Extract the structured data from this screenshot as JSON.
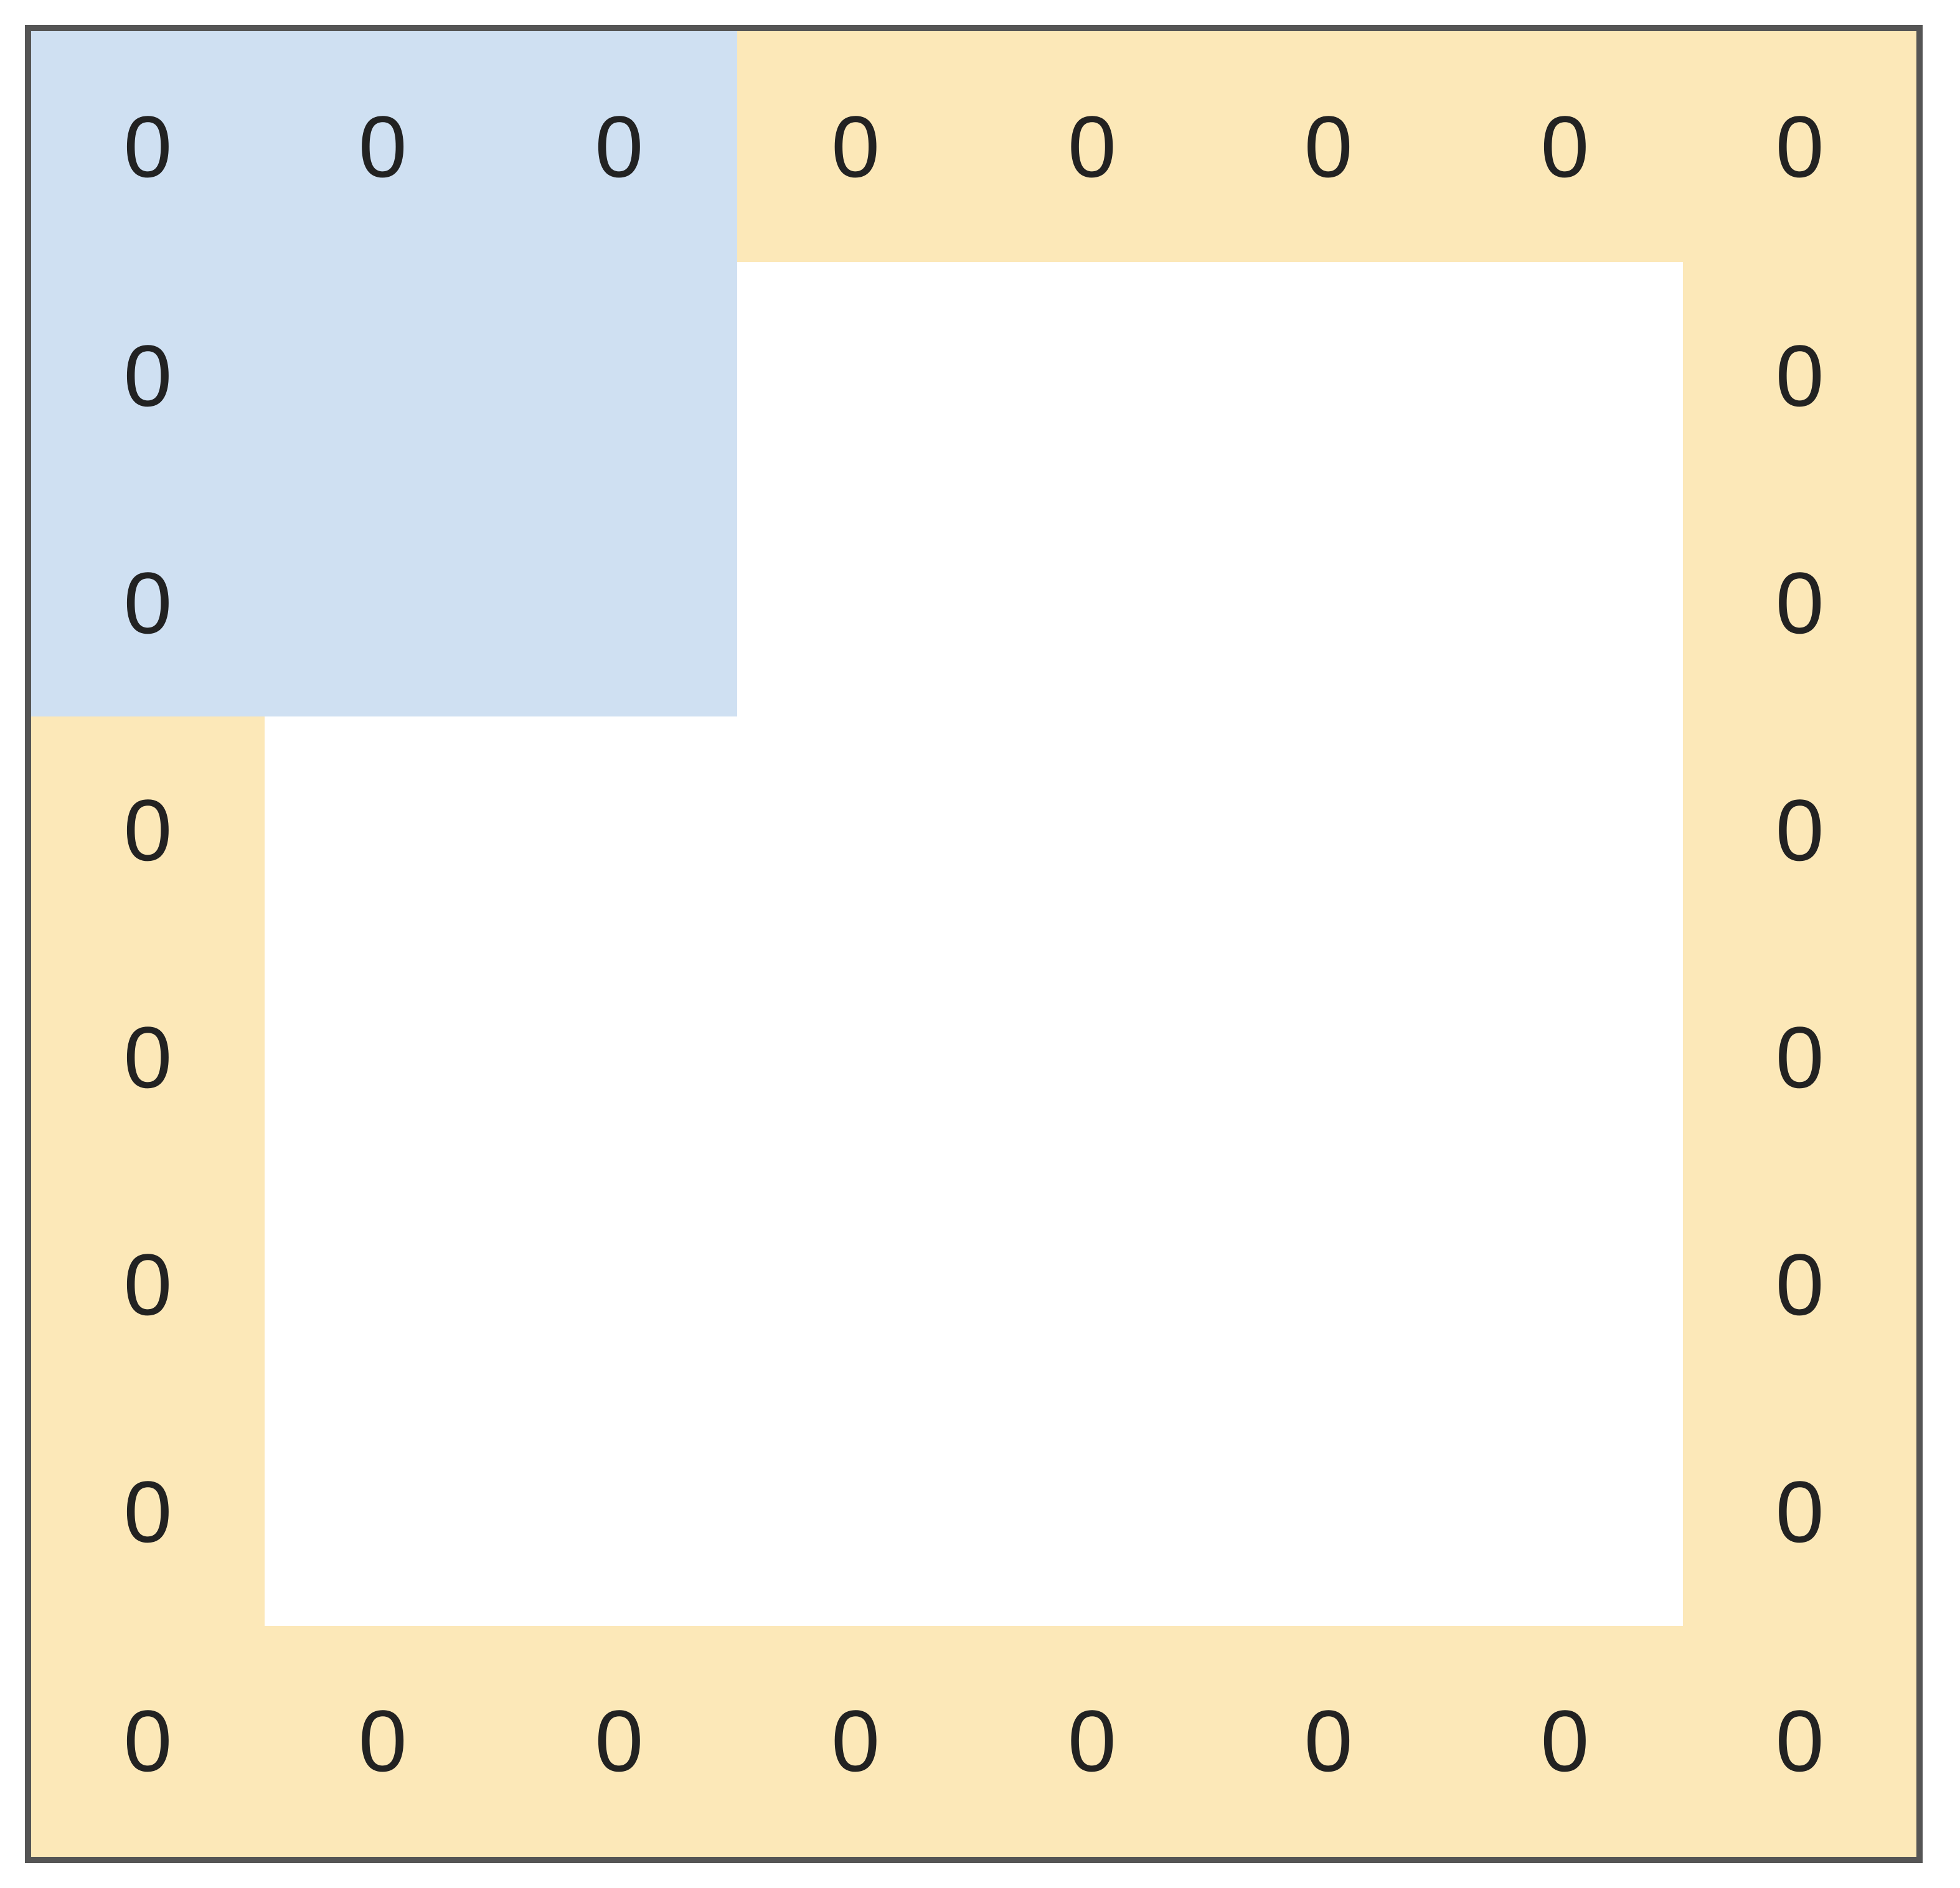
{
  "grid": {
    "rows": 8,
    "cols": 8,
    "blue_block": {
      "row_start": 0,
      "row_end": 2,
      "col_start": 0,
      "col_end": 2
    },
    "cells": [
      [
        {
          "text": "0",
          "zone": "blue"
        },
        {
          "text": "0",
          "zone": "blue"
        },
        {
          "text": "0",
          "zone": "blue"
        },
        {
          "text": "0",
          "zone": "tan"
        },
        {
          "text": "0",
          "zone": "tan"
        },
        {
          "text": "0",
          "zone": "tan"
        },
        {
          "text": "0",
          "zone": "tan"
        },
        {
          "text": "0",
          "zone": "tan"
        }
      ],
      [
        {
          "text": "0",
          "zone": "blue"
        },
        {
          "text": "",
          "zone": "blue"
        },
        {
          "text": "",
          "zone": "blue"
        },
        {
          "text": "",
          "zone": "white"
        },
        {
          "text": "",
          "zone": "white"
        },
        {
          "text": "",
          "zone": "white"
        },
        {
          "text": "",
          "zone": "white"
        },
        {
          "text": "0",
          "zone": "tan"
        }
      ],
      [
        {
          "text": "0",
          "zone": "blue"
        },
        {
          "text": "",
          "zone": "blue"
        },
        {
          "text": "",
          "zone": "blue"
        },
        {
          "text": "",
          "zone": "white"
        },
        {
          "text": "",
          "zone": "white"
        },
        {
          "text": "",
          "zone": "white"
        },
        {
          "text": "",
          "zone": "white"
        },
        {
          "text": "0",
          "zone": "tan"
        }
      ],
      [
        {
          "text": "0",
          "zone": "tan"
        },
        {
          "text": "",
          "zone": "white"
        },
        {
          "text": "",
          "zone": "white"
        },
        {
          "text": "",
          "zone": "white"
        },
        {
          "text": "",
          "zone": "white"
        },
        {
          "text": "",
          "zone": "white"
        },
        {
          "text": "",
          "zone": "white"
        },
        {
          "text": "0",
          "zone": "tan"
        }
      ],
      [
        {
          "text": "0",
          "zone": "tan"
        },
        {
          "text": "",
          "zone": "white"
        },
        {
          "text": "",
          "zone": "white"
        },
        {
          "text": "",
          "zone": "white"
        },
        {
          "text": "",
          "zone": "white"
        },
        {
          "text": "",
          "zone": "white"
        },
        {
          "text": "",
          "zone": "white"
        },
        {
          "text": "0",
          "zone": "tan"
        }
      ],
      [
        {
          "text": "0",
          "zone": "tan"
        },
        {
          "text": "",
          "zone": "white"
        },
        {
          "text": "",
          "zone": "white"
        },
        {
          "text": "",
          "zone": "white"
        },
        {
          "text": "",
          "zone": "white"
        },
        {
          "text": "",
          "zone": "white"
        },
        {
          "text": "",
          "zone": "white"
        },
        {
          "text": "0",
          "zone": "tan"
        }
      ],
      [
        {
          "text": "0",
          "zone": "tan"
        },
        {
          "text": "",
          "zone": "white"
        },
        {
          "text": "",
          "zone": "white"
        },
        {
          "text": "",
          "zone": "white"
        },
        {
          "text": "",
          "zone": "white"
        },
        {
          "text": "",
          "zone": "white"
        },
        {
          "text": "",
          "zone": "white"
        },
        {
          "text": "0",
          "zone": "tan"
        }
      ],
      [
        {
          "text": "0",
          "zone": "tan"
        },
        {
          "text": "0",
          "zone": "tan"
        },
        {
          "text": "0",
          "zone": "tan"
        },
        {
          "text": "0",
          "zone": "tan"
        },
        {
          "text": "0",
          "zone": "tan"
        },
        {
          "text": "0",
          "zone": "tan"
        },
        {
          "text": "0",
          "zone": "tan"
        },
        {
          "text": "0",
          "zone": "tan"
        }
      ]
    ]
  },
  "colors": {
    "blue": "#cfe0f2",
    "tan": "#fce8b8",
    "white": "#ffffff",
    "outer_border": "#555555",
    "black_border": "#000000",
    "blue_internal_border": "#a9bfd6",
    "tan_internal_border": "#e7cf95"
  }
}
